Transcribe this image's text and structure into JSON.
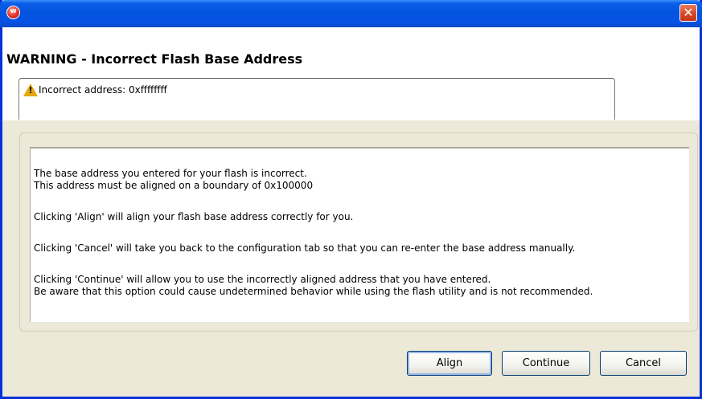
{
  "window": {
    "app_icon_letter": "w",
    "close_glyph": "✕"
  },
  "header": {
    "title": "WARNING - Incorrect Flash Base Address",
    "message": "Incorrect address: 0xffffffff",
    "message_icon": "warning-icon"
  },
  "body": {
    "lines": [
      "The base address you entered for your flash is incorrect.",
      "This address must be aligned on a boundary of 0x100000",
      "Clicking 'Align' will align your flash base address correctly for you.",
      "Clicking 'Cancel' will take you back to the configuration tab so that you can re-enter the base address manually.",
      "Clicking 'Continue' will allow you to use the incorrectly aligned address that you have entered.",
      "Be aware that this option could cause undetermined behavior while using the flash utility and is not recommended."
    ]
  },
  "buttons": {
    "align": "Align",
    "continue": "Continue",
    "cancel": "Cancel"
  },
  "colors": {
    "titlebar": "#0453df",
    "warning": "#e3a70f",
    "close": "#d9451f"
  }
}
